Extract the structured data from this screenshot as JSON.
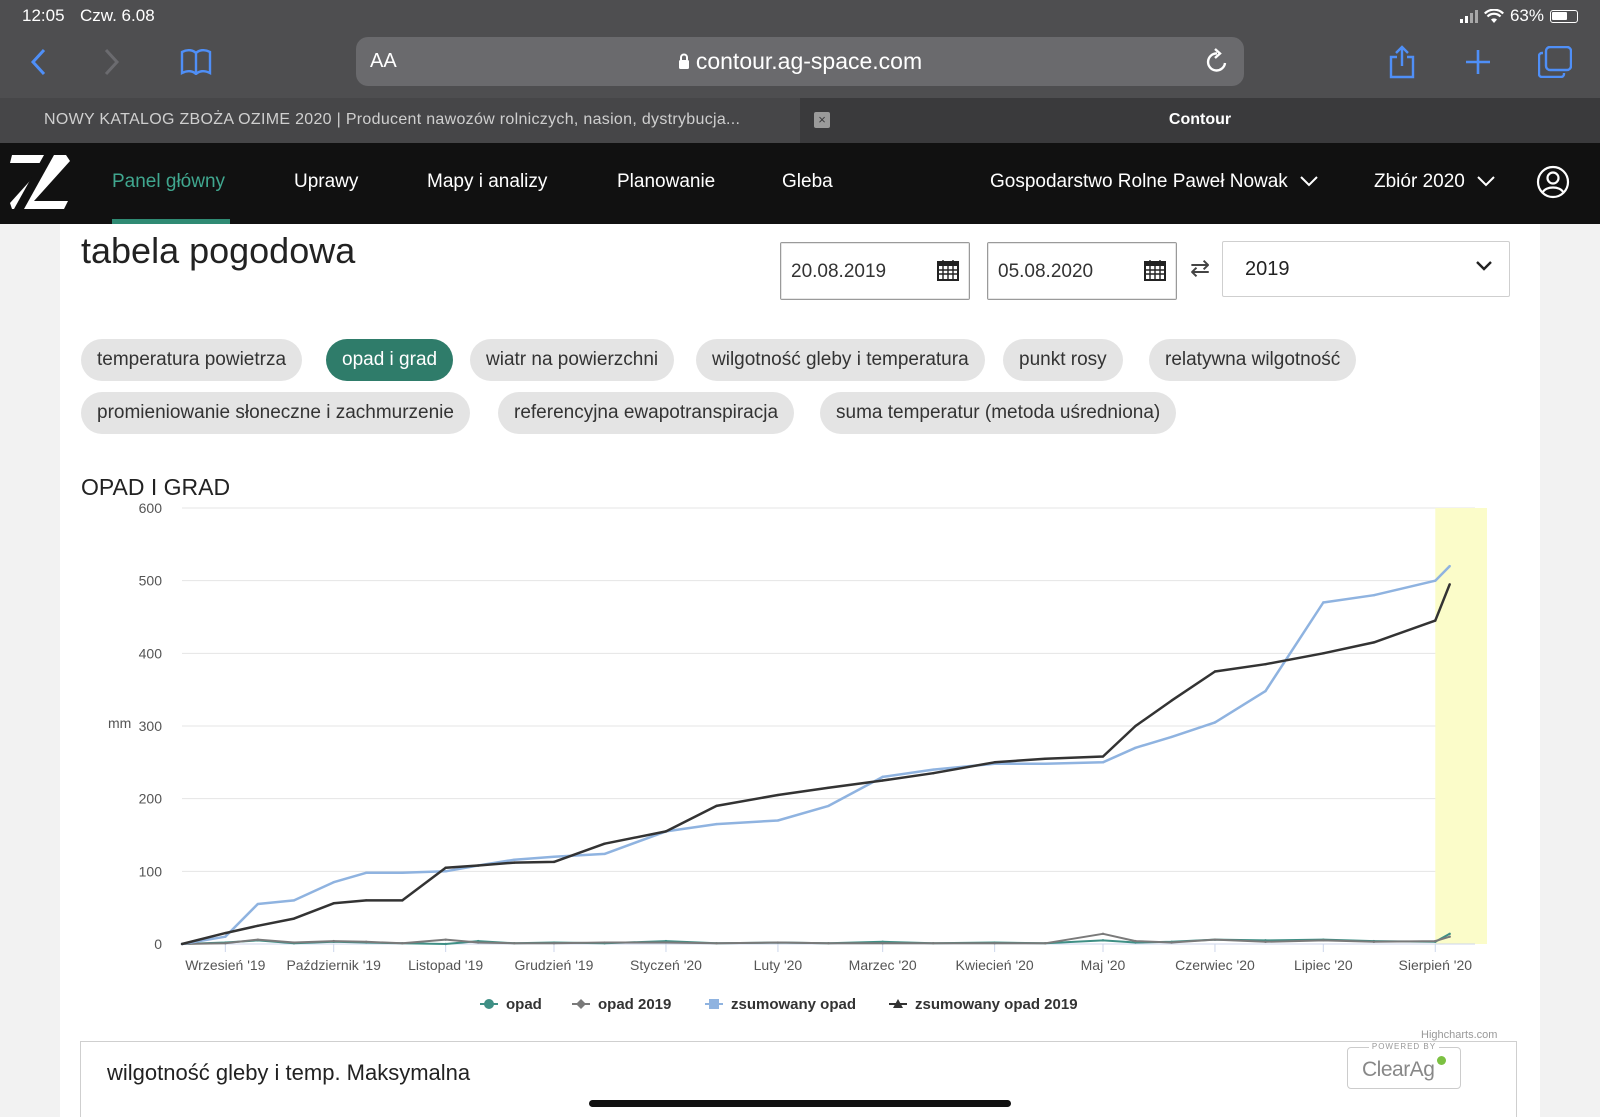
{
  "status_bar": {
    "time": "12:05",
    "date": "Czw. 6.08",
    "battery": "63%"
  },
  "browser": {
    "aa_label": "AA",
    "url": "contour.ag-space.com",
    "tabs": [
      {
        "label": "NOWY KATALOG ZBOŻA OZIME 2020 | Producent nawozów rolniczych, nasion, dystrybucja...",
        "active": false
      },
      {
        "label": "Contour",
        "active": true
      }
    ],
    "tab_close_glyph": "×"
  },
  "nav": {
    "items": [
      {
        "label": "Panel główny",
        "active": true
      },
      {
        "label": "Uprawy"
      },
      {
        "label": "Mapy i analizy"
      },
      {
        "label": "Planowanie"
      },
      {
        "label": "Gleba"
      }
    ],
    "farm": "Gospodarstwo Rolne Paweł Nowak",
    "season": "Zbiór 2020"
  },
  "page": {
    "title": "tabela pogodowa",
    "date_from": "20.08.2019",
    "date_to": "05.08.2020",
    "swap_glyph": "⇄",
    "year": "2019"
  },
  "chips": [
    {
      "label": "temperatura powietrza",
      "active": false
    },
    {
      "label": "opad i grad",
      "active": true
    },
    {
      "label": "wiatr na powierzchni",
      "active": false
    },
    {
      "label": "wilgotność gleby i temperatura",
      "active": false
    },
    {
      "label": "punkt rosy",
      "active": false
    },
    {
      "label": "relatywna wilgotność",
      "active": false
    },
    {
      "label": "promieniowanie słoneczne i zachmurzenie",
      "active": false
    },
    {
      "label": "referencyjna ewapotranspiracja",
      "active": false
    },
    {
      "label": "suma temperatur (metoda uśredniona)",
      "active": false
    }
  ],
  "chart_title": "OPAD I GRAD",
  "chart_data": {
    "type": "line",
    "title": "OPAD I GRAD",
    "ylabel": "mm",
    "xlabel": "",
    "ylim": [
      0,
      600
    ],
    "yticks": [
      "0",
      "100",
      "200",
      "300",
      "400",
      "500",
      "600"
    ],
    "xtick_labels": [
      "Wrzesień '19",
      "Październik '19",
      "Listopad '19",
      "Grudzień '19",
      "Styczeń '20",
      "Luty '20",
      "Marzec '20",
      "Kwiecień '20",
      "Maj '20",
      "Czerwiec '20",
      "Lipiec '20",
      "Sierpień '20"
    ],
    "x": [
      "2019-08-20",
      "2019-09-01",
      "2019-09-10",
      "2019-09-20",
      "2019-10-01",
      "2019-10-10",
      "2019-10-20",
      "2019-11-01",
      "2019-11-10",
      "2019-11-20",
      "2019-12-01",
      "2019-12-15",
      "2020-01-01",
      "2020-01-15",
      "2020-02-01",
      "2020-02-15",
      "2020-03-01",
      "2020-03-15",
      "2020-04-01",
      "2020-04-15",
      "2020-05-01",
      "2020-05-10",
      "2020-05-20",
      "2020-06-01",
      "2020-06-15",
      "2020-07-01",
      "2020-07-15",
      "2020-08-01",
      "2020-08-05"
    ],
    "highlight_range": [
      "2020-08-01",
      "2020-08-05"
    ],
    "grid": true,
    "legend_position": "bottom",
    "series": [
      {
        "name": "opad",
        "type": "line",
        "color": "#3f8f85",
        "marker": "circle",
        "values": [
          0,
          2,
          5,
          1,
          3,
          2,
          1,
          0,
          4,
          1,
          2,
          1,
          4,
          1,
          2,
          1,
          3,
          1,
          2,
          1,
          5,
          2,
          3,
          6,
          5,
          6,
          4,
          3,
          14
        ]
      },
      {
        "name": "opad 2019",
        "type": "line",
        "color": "#7a7a7a",
        "marker": "diamond",
        "values": [
          0,
          1,
          6,
          2,
          4,
          3,
          1,
          6,
          2,
          1,
          1,
          2,
          2,
          1,
          2,
          1,
          1,
          1,
          1,
          1,
          14,
          4,
          2,
          6,
          3,
          5,
          3,
          4,
          10
        ]
      },
      {
        "name": "zsumowany opad",
        "type": "line",
        "color": "#8fb3e0",
        "marker": "square",
        "values": [
          0,
          10,
          55,
          60,
          85,
          98,
          98,
          100,
          108,
          116,
          120,
          124,
          155,
          165,
          170,
          190,
          230,
          240,
          248,
          248,
          250,
          270,
          285,
          305,
          348,
          470,
          480,
          500,
          520
        ]
      },
      {
        "name": "zsumowany opad 2019",
        "type": "line",
        "color": "#333333",
        "marker": "triangle",
        "values": [
          0,
          15,
          25,
          35,
          56,
          60,
          60,
          105,
          108,
          112,
          113,
          138,
          155,
          190,
          205,
          215,
          225,
          235,
          250,
          255,
          258,
          300,
          335,
          375,
          385,
          400,
          415,
          445,
          495
        ]
      }
    ],
    "legend": [
      "opad",
      "opad 2019",
      "zsumowany opad",
      "zsumowany opad 2019"
    ]
  },
  "chart_credit": "Highcharts.com",
  "next_section_title": "wilgotność gleby i temp. Maksymalna",
  "powered_by": "POWERED BY",
  "brand_logo": "ClearAg"
}
